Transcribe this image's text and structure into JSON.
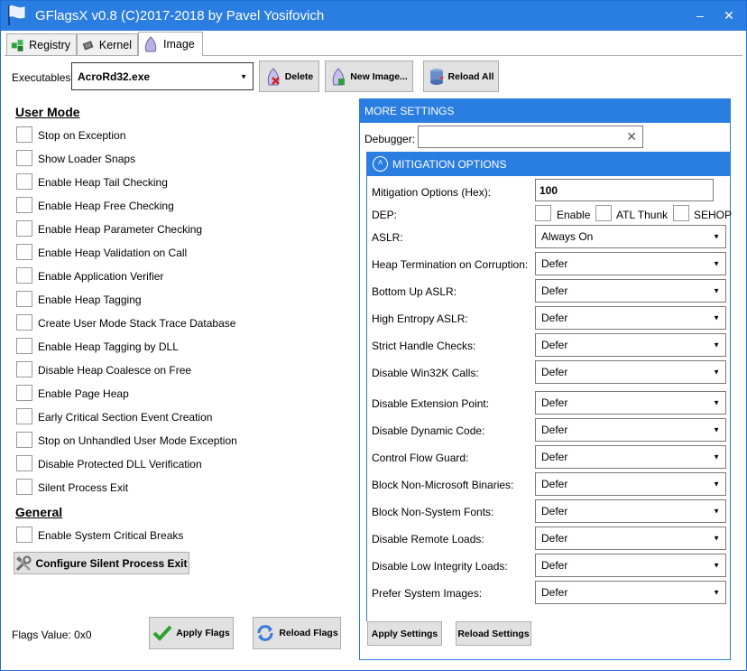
{
  "window": {
    "title": "GFlagsX v0.8 (C)2017-2018 by Pavel Yosifovich",
    "minimize_icon": "minimize-icon",
    "close_icon": "close-icon"
  },
  "tabs": [
    {
      "label": "Registry",
      "icon": "registry-icon"
    },
    {
      "label": "Kernel",
      "icon": "chip-icon"
    },
    {
      "label": "Image",
      "icon": "image-icon",
      "active": true
    }
  ],
  "executables": {
    "label": "Executables:",
    "value": "AcroRd32.exe"
  },
  "toolbar": {
    "delete": "Delete",
    "new_image": "New Image...",
    "reload_all": "Reload All"
  },
  "user_mode": {
    "title": "User Mode",
    "items": [
      "Stop on Exception",
      "Show Loader Snaps",
      "Enable Heap Tail Checking",
      "Enable Heap Free Checking",
      "Enable Heap Parameter Checking",
      "Enable Heap Validation on Call",
      "Enable Application Verifier",
      "Enable Heap Tagging",
      "Create User Mode Stack Trace Database",
      "Enable Heap Tagging by DLL",
      "Disable Heap Coalesce on Free",
      "Enable Page Heap",
      "Early Critical Section Event Creation",
      "Stop on Unhandled User Mode Exception",
      "Disable Protected DLL Verification",
      "Silent Process Exit"
    ]
  },
  "general": {
    "title": "General",
    "items": [
      "Enable System Critical Breaks"
    ]
  },
  "configure_button": "Configure Silent Process Exit",
  "flags_value": "Flags Value: 0x0",
  "apply_flags": "Apply Flags",
  "reload_flags": "Reload Flags",
  "more_settings": {
    "title": "MORE SETTINGS",
    "debugger_label": "Debugger:",
    "debugger_value": "",
    "mitigation": {
      "title": "MITIGATION OPTIONS",
      "hex_label": "Mitigation Options (Hex):",
      "hex_value": "100",
      "dep_label": "DEP:",
      "dep_options": [
        "Enable",
        "ATL Thunk",
        "SEHOP"
      ],
      "rows": [
        {
          "label": "ASLR:",
          "value": "Always On"
        },
        {
          "label": "Heap Termination on Corruption:",
          "value": "Defer"
        },
        {
          "label": "Bottom Up ASLR:",
          "value": "Defer"
        },
        {
          "label": "High Entropy ASLR:",
          "value": "Defer"
        },
        {
          "label": "Strict Handle Checks:",
          "value": "Defer"
        },
        {
          "label": "Disable Win32K Calls:",
          "value": "Defer"
        },
        {
          "label": "Disable Extension Point:",
          "value": "Defer"
        },
        {
          "label": "Disable Dynamic Code:",
          "value": "Defer"
        },
        {
          "label": "Control Flow Guard:",
          "value": "Defer"
        },
        {
          "label": "Block Non-Microsoft Binaries:",
          "value": "Defer"
        },
        {
          "label": "Block Non-System Fonts:",
          "value": "Defer"
        },
        {
          "label": "Disable Remote Loads:",
          "value": "Defer"
        },
        {
          "label": "Disable Low Integrity Loads:",
          "value": "Defer"
        },
        {
          "label": "Prefer System Images:",
          "value": "Defer"
        }
      ]
    },
    "apply_settings": "Apply Settings",
    "reload_settings": "Reload Settings"
  }
}
